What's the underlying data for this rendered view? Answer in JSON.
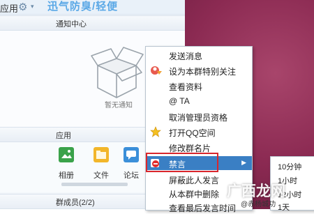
{
  "topbar": {
    "app_label": "应用",
    "slogan": "迅气防臭/轻便"
  },
  "notify": {
    "header": "通知中心",
    "empty_text": "暂无通知"
  },
  "apps": {
    "header": "应用",
    "tiles": [
      {
        "label": "相册",
        "color": "#3aa24a"
      },
      {
        "label": "文件",
        "color": "#f2b62a"
      },
      {
        "label": "论坛",
        "color": "#3b8fd9"
      }
    ]
  },
  "members": {
    "header": "群成员(2/2)"
  },
  "context_menu": {
    "items": [
      {
        "label": "发送消息",
        "icon": ""
      },
      {
        "label": "设为本群特别关注",
        "icon": "special-follow-icon"
      },
      {
        "label": "查看资料",
        "icon": ""
      },
      {
        "label": "@ TA",
        "icon": ""
      },
      {
        "label": "取消管理员资格",
        "icon": ""
      },
      {
        "label": "打开QQ空间",
        "icon": "star-icon"
      },
      {
        "label": "修改群名片",
        "icon": ""
      },
      {
        "label": "禁言",
        "icon": "mute-icon"
      },
      {
        "label": "屏蔽此人发言",
        "icon": ""
      },
      {
        "label": "从本群中删除",
        "icon": ""
      },
      {
        "label": "查看最后发言时间",
        "icon": ""
      }
    ],
    "highlighted_index": 7,
    "highlight_color": "#3a7fc4",
    "annotation_color": "#d9262c"
  },
  "submenu": {
    "items": [
      "10分钟",
      "1小时",
      "12小时",
      "1天"
    ]
  },
  "watermark": {
    "big": "广西龙网",
    "small": "@赤杨城功"
  },
  "colors": {
    "background_right": "#8b2a52",
    "slogan": "#5aa8e6"
  }
}
